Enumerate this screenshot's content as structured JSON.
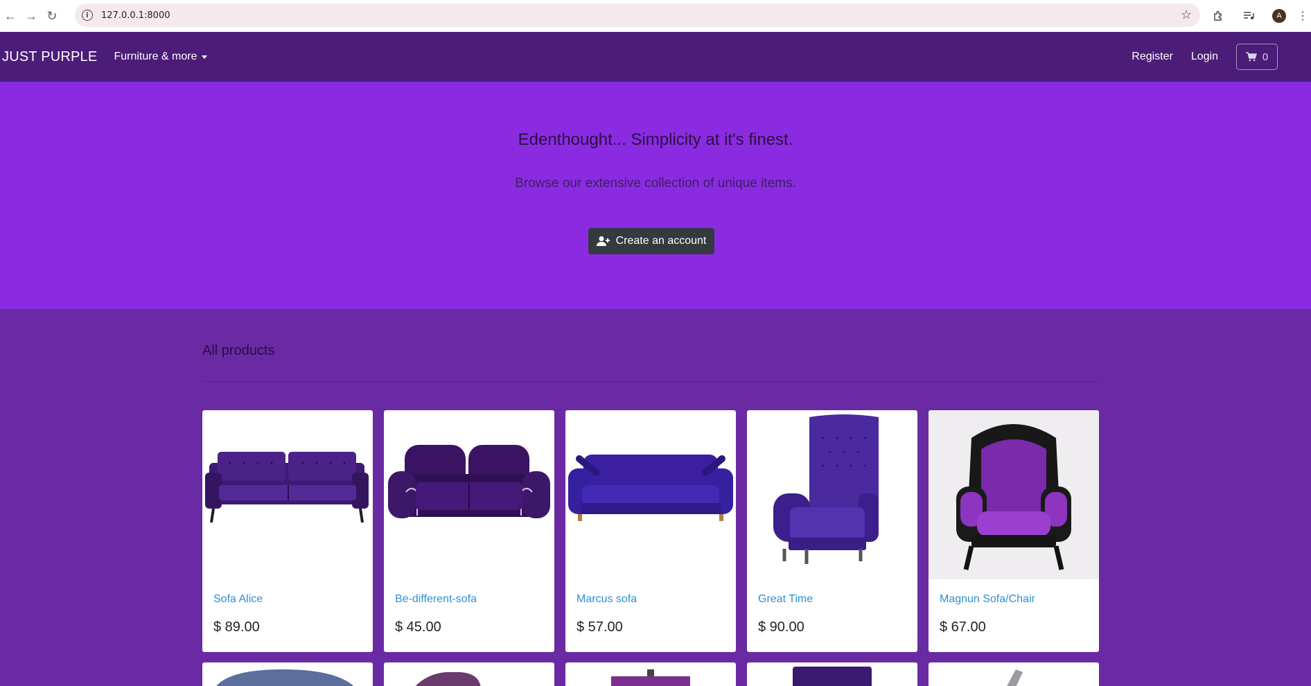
{
  "browser": {
    "url": "127.0.0.1:8000",
    "profile_initial": "A"
  },
  "navbar": {
    "brand": "JUST PURPLE",
    "dropdown_label": "Furniture & more",
    "register_label": "Register",
    "login_label": "Login",
    "cart_count": "0"
  },
  "hero": {
    "title": "Edenthought... Simplicity at it's finest.",
    "subtitle": "Browse our extensive collection of unique items.",
    "cta_label": "Create an account"
  },
  "products": {
    "heading": "All products",
    "items": [
      {
        "name": "Sofa Alice",
        "price": "$ 89.00"
      },
      {
        "name": "Be-different-sofa",
        "price": "$ 45.00"
      },
      {
        "name": "Marcus sofa",
        "price": "$ 57.00"
      },
      {
        "name": "Great Time",
        "price": "$ 90.00"
      },
      {
        "name": "Magnun Sofa/Chair",
        "price": "$ 67.00"
      }
    ]
  },
  "colors": {
    "navbar_bg": "#4b1c78",
    "hero_bg": "#8a2be2",
    "page_bg": "#6a2aa3",
    "link": "#2d8fd5",
    "button_dark": "#343a40"
  }
}
